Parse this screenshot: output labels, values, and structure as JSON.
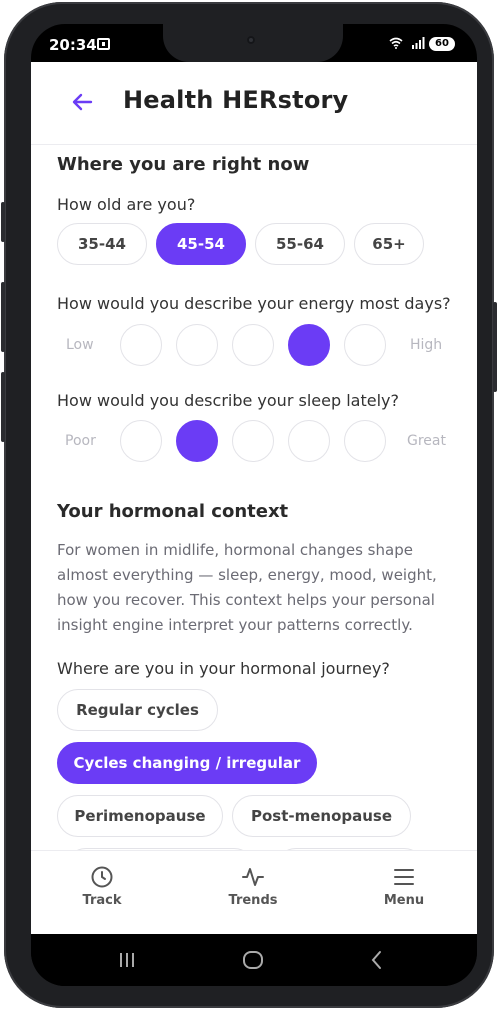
{
  "status": {
    "time": "20:34",
    "battery": "60"
  },
  "header": {
    "title": "Health HERstory"
  },
  "section1": {
    "title": "Where you are right now",
    "age": {
      "question": "How old are you?",
      "options": [
        "35-44",
        "45-54",
        "55-64",
        "65+"
      ],
      "selected": "45-54"
    },
    "energy": {
      "question": "How would you describe your energy most days?",
      "low_label": "Low",
      "high_label": "High",
      "selected_level": 4,
      "levels": 5
    },
    "sleep": {
      "question": "How would you describe your sleep lately?",
      "low_label": "Poor",
      "high_label": "Great",
      "selected_level": 2,
      "levels": 5
    }
  },
  "section2": {
    "title": "Your hormonal context",
    "description": "For women in midlife, hormonal changes shape almost everything — sleep, energy, mood, weight, how you recover. This context helps your personal insight engine interpret your patterns correctly.",
    "journey": {
      "question": "Where are you in your hormonal journey?",
      "options": [
        "Regular cycles",
        "Cycles changing / irregular",
        "Perimenopause",
        "Post-menopause"
      ],
      "selected": "Cycles changing / irregular"
    }
  },
  "nav": {
    "track": "Track",
    "trends": "Trends",
    "menu": "Menu"
  },
  "colors": {
    "accent": "#6b3cf5",
    "border": "#e3e3e8"
  }
}
